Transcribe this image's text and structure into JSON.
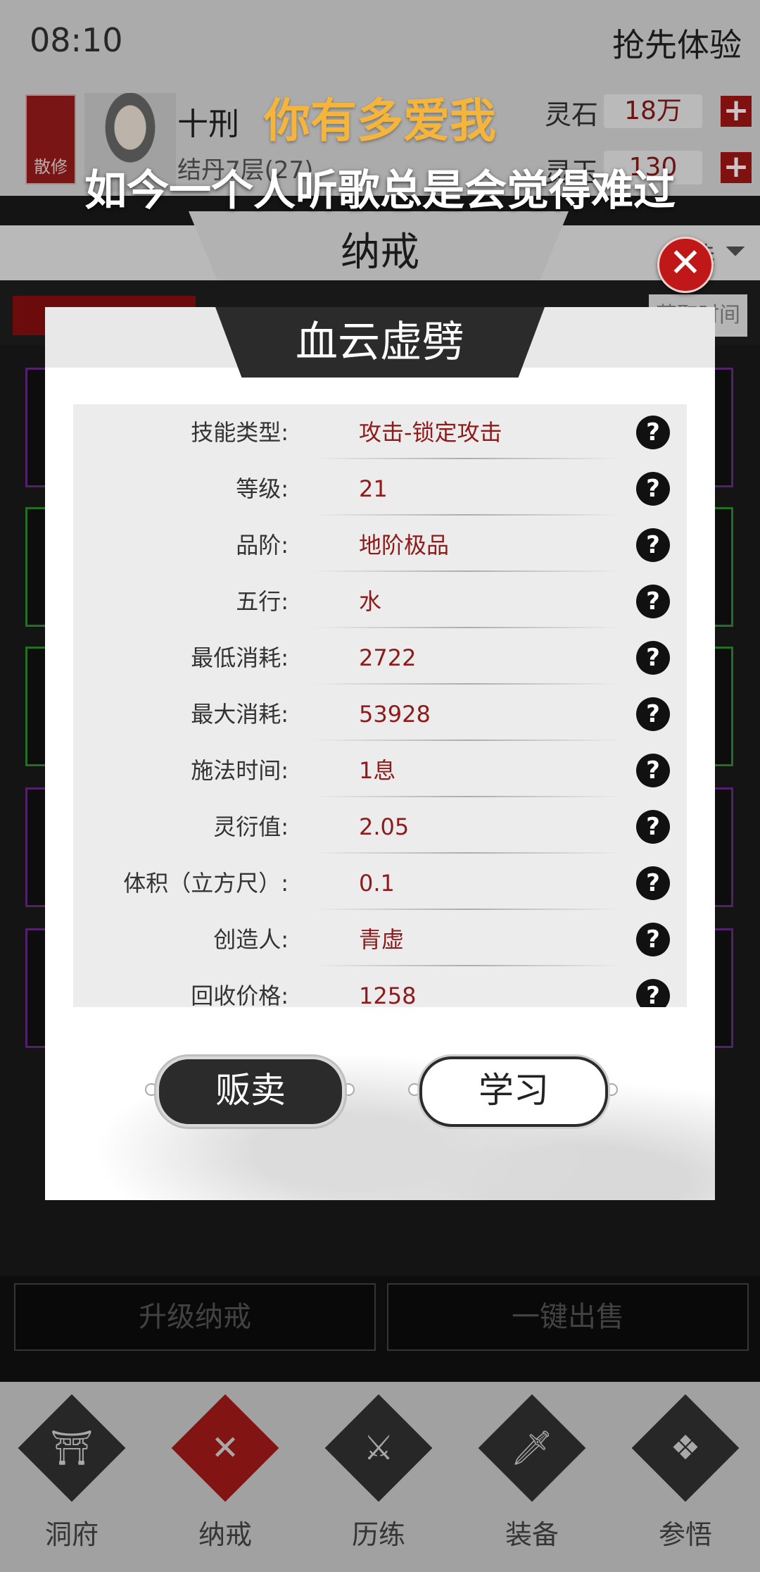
{
  "status_bar": {
    "time": "08:10",
    "trial_label": "抢先体验"
  },
  "header": {
    "sect_badge": "散修",
    "character_name": "十刑",
    "character_level": "结丹7层(27)",
    "resources": [
      {
        "label": "灵石",
        "value": "18万"
      },
      {
        "label": "灵玉",
        "value": "130"
      }
    ]
  },
  "lyrics": {
    "line1": "你有多爱我",
    "line2": "如今一个人听歌总是会觉得难过"
  },
  "background_page": {
    "tab_title": "纳戒",
    "filter_label": "筛选",
    "sort_time_label": "获取时间"
  },
  "modal": {
    "title": "血云虚劈",
    "stats": [
      {
        "key": "技能类型:",
        "value": "攻击-锁定攻击"
      },
      {
        "key": "等级:",
        "value": "21"
      },
      {
        "key": "品阶:",
        "value": "地阶极品"
      },
      {
        "key": "五行:",
        "value": "水"
      },
      {
        "key": "最低消耗:",
        "value": "2722"
      },
      {
        "key": "最大消耗:",
        "value": "53928"
      },
      {
        "key": "施法时间:",
        "value": "1息"
      },
      {
        "key": "灵衍值:",
        "value": "2.05"
      },
      {
        "key": "体积（立方尺）:",
        "value": "0.1"
      },
      {
        "key": "创造人:",
        "value": "青虚"
      },
      {
        "key": "回收价格:",
        "value": "1258"
      }
    ],
    "help_glyph": "?",
    "sell_label": "贩卖",
    "learn_label": "学习"
  },
  "footer_buttons": {
    "upgrade_label": "升级纳戒",
    "sell_all_label": "一键出售"
  },
  "nav": [
    {
      "label": "洞府",
      "icon": "gate-icon"
    },
    {
      "label": "纳戒",
      "icon": "ring-icon"
    },
    {
      "label": "历练",
      "icon": "swords-icon"
    },
    {
      "label": "装备",
      "icon": "sword-icon"
    },
    {
      "label": "参悟",
      "icon": "book-icon"
    }
  ],
  "colors": {
    "accent_red": "#a41616",
    "value_red": "#8e1b1b",
    "lyric_gold": "#f5b53a"
  }
}
